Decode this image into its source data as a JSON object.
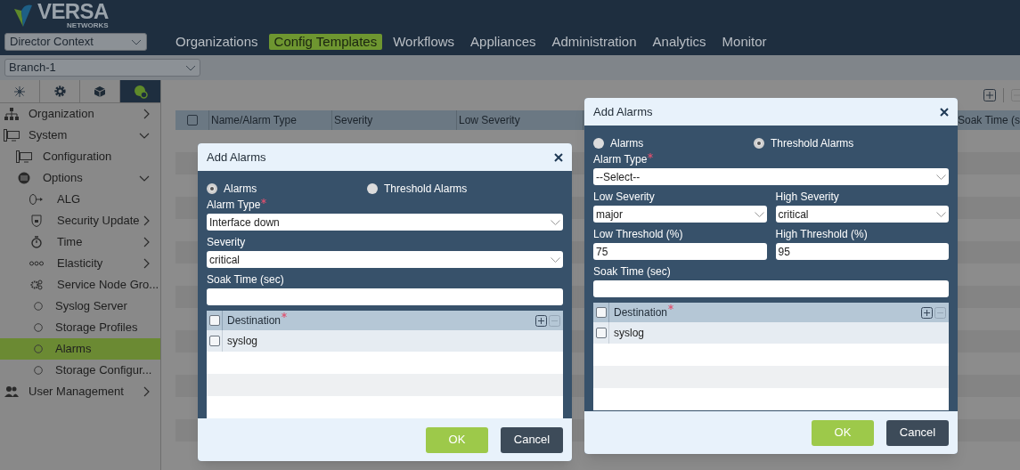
{
  "header": {
    "logo_text": "VERSA",
    "logo_subtext": "NETWORKS",
    "context_select": "Director Context",
    "nav": [
      {
        "label": "Organizations",
        "selected": false
      },
      {
        "label": "Config Templates",
        "selected": true
      },
      {
        "label": "Workflows",
        "selected": false
      },
      {
        "label": "Appliances",
        "selected": false
      },
      {
        "label": "Administration",
        "selected": false
      },
      {
        "label": "Analytics",
        "selected": false
      },
      {
        "label": "Monitor",
        "selected": false
      }
    ]
  },
  "branch_select": "Branch-1",
  "sidebar": {
    "tabs": [
      {
        "selected": false
      },
      {
        "selected": false
      },
      {
        "selected": false
      },
      {
        "selected": true
      }
    ],
    "items": [
      {
        "label": "Organization",
        "expanded": false,
        "selected": false
      },
      {
        "label": "System",
        "expanded": true,
        "selected": false,
        "children": [
          {
            "label": "Configuration",
            "selected": false
          },
          {
            "label": "Options",
            "expanded": true,
            "selected": false,
            "children": [
              {
                "label": "ALG",
                "selected": false
              },
              {
                "label": "Security Update",
                "expanded": false,
                "selected": false
              },
              {
                "label": "Time",
                "expanded": false,
                "selected": false
              },
              {
                "label": "Elasticity",
                "expanded": false,
                "selected": false
              },
              {
                "label": "Service Node Gro...",
                "selected": false
              },
              {
                "label": "Syslog Server",
                "selected": false
              },
              {
                "label": "Storage Profiles",
                "selected": false
              },
              {
                "label": "Alarms",
                "selected": true
              },
              {
                "label": "Storage Configur...",
                "selected": false
              }
            ]
          }
        ]
      },
      {
        "label": "User Management",
        "expanded": false,
        "selected": false
      }
    ]
  },
  "table": {
    "checked": false,
    "columns": [
      "Name/Alarm Type",
      "Severity",
      "Low Severity",
      "Soak Time (s"
    ]
  },
  "dialogs": [
    {
      "title": "Add Alarms",
      "radios": [
        {
          "label": "Alarms",
          "selected": true
        },
        {
          "label": "Threshold Alarms",
          "selected": false
        }
      ],
      "rows": [
        [
          {
            "label": "Alarm Type",
            "required": true,
            "kind": "select",
            "value": "Interface down"
          }
        ],
        [
          {
            "label": "Severity",
            "required": false,
            "kind": "select",
            "value": "critical"
          }
        ],
        [
          {
            "label": "Soak Time (sec)",
            "required": false,
            "kind": "text"
          }
        ]
      ],
      "destination": {
        "header": "Destination",
        "required": true,
        "checked": false,
        "rows": [
          {
            "value": "syslog",
            "checked": false
          }
        ]
      },
      "buttons": [
        "OK",
        "Cancel"
      ]
    },
    {
      "title": "Add Alarms",
      "radios": [
        {
          "label": "Alarms",
          "selected": false
        },
        {
          "label": "Threshold Alarms",
          "selected": true
        }
      ],
      "rows": [
        [
          {
            "label": "Alarm Type",
            "required": true,
            "kind": "select",
            "value": "--Select--"
          }
        ],
        [
          {
            "label": "Low Severity",
            "required": false,
            "kind": "select",
            "value": "major"
          },
          {
            "label": "High Severity",
            "required": false,
            "kind": "select",
            "value": "critical"
          }
        ],
        [
          {
            "label": "Low Threshold (%)",
            "required": false,
            "kind": "text",
            "value": "75"
          },
          {
            "label": "High Threshold (%)",
            "required": false,
            "kind": "text",
            "value": "95"
          }
        ],
        [
          {
            "label": "Soak Time (sec)",
            "required": false,
            "kind": "text"
          }
        ]
      ],
      "destination": {
        "header": "Destination",
        "required": true,
        "checked": false,
        "rows": [
          {
            "value": "syslog",
            "checked": false
          }
        ]
      },
      "buttons": [
        "OK",
        "Cancel"
      ]
    }
  ]
}
